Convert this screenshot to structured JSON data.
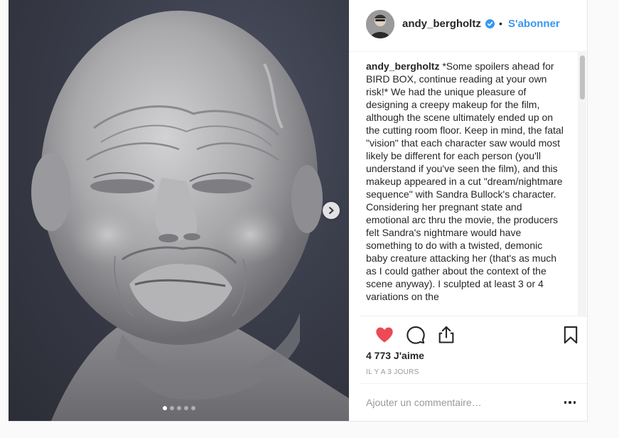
{
  "post": {
    "author": {
      "username": "andy_bergholtz",
      "verified": true,
      "avatar_icon": "avatar-photo"
    },
    "header": {
      "separator": "•",
      "follow_label": "S'abonner"
    },
    "caption": {
      "username": "andy_bergholtz",
      "text": " *Some spoilers ahead for BIRD BOX, continue reading at your own risk!* We had the unique pleasure of designing a creepy makeup for the film, although the scene ultimately ended up on the cutting room floor. Keep in mind, the fatal \"vision\" that each character saw would most likely be different for each person (you'll understand if you've seen the film), and this makeup appeared in a cut \"dream/nightmare sequence\" with Sandra Bullock's character.\nConsidering her pregnant state and emotional arc thru the movie, the producers felt Sandra's nightmare would have something to do with a twisted, demonic baby creature attacking her (that's as much as I could gather about the context of the scene anyway). I sculpted at least 3 or 4 variations on the"
    },
    "actions": {
      "like_icon": "heart-filled-icon",
      "comment_icon": "comment-icon",
      "share_icon": "share-icon",
      "save_icon": "bookmark-icon",
      "liked": true
    },
    "likes_text": "4 773 J'aime",
    "time_text": "IL Y A 3 JOURS",
    "comment": {
      "placeholder": "Ajouter un commentaire…",
      "value": ""
    },
    "more_icon": "more-options-icon",
    "carousel": {
      "total": 5,
      "current": 1,
      "next_icon": "chevron-right-icon"
    },
    "colors": {
      "link": "#3897f0",
      "like": "#ed4956",
      "text": "#262626",
      "muted": "#999999"
    }
  }
}
